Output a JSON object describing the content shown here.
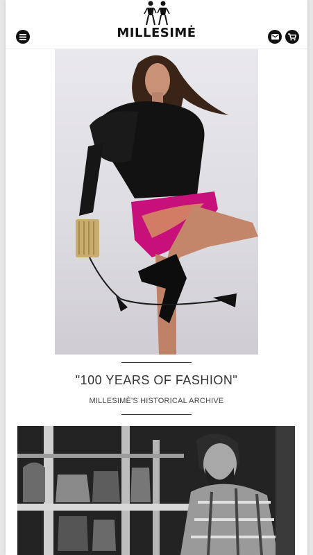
{
  "header": {
    "brand": "MILLESIMĖ",
    "menu_icon": "menu-icon",
    "mail_icon": "envelope-icon",
    "cart_icon": "cart-icon"
  },
  "main": {
    "title": "\"100 YEARS OF FASHION\"",
    "subtitle": "MILLESIMÈ'S HISTORICAL ARCHIVE"
  },
  "colors": {
    "accent_pink": "#c8107a",
    "dark": "#111111"
  }
}
